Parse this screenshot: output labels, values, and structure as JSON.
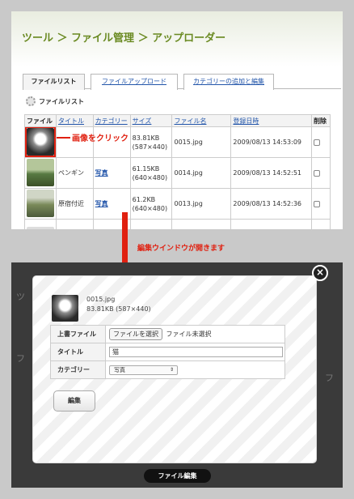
{
  "breadcrumb": "ツール ＞ ファイル管理 ＞ アップローダー",
  "tabs": [
    {
      "label": "ファイルリスト",
      "active": true
    },
    {
      "label": "ファイルアップロード",
      "active": false
    },
    {
      "label": "カテゴリーの追加と編集",
      "active": false
    }
  ],
  "section_title": "ファイルリスト",
  "table": {
    "headers": [
      "ファイル",
      "タイトル",
      "カテゴリー",
      "サイズ",
      "ファイル名",
      "登録日時",
      "削除"
    ],
    "rows": [
      {
        "title": "",
        "category": "",
        "size": "83.81KB",
        "dims": "(587×440)",
        "filename": "0015.jpg",
        "date": "2009/08/13 14:53:09"
      },
      {
        "title": "ペンギン",
        "category": "写真",
        "size": "61.15KB",
        "dims": "(640×480)",
        "filename": "0014.jpg",
        "date": "2009/08/13 14:52:51"
      },
      {
        "title": "原宿付近",
        "category": "写真",
        "size": "61.2KB",
        "dims": "(640×480)",
        "filename": "0013.jpg",
        "date": "2009/08/13 14:52:36"
      }
    ]
  },
  "callout": {
    "click_text": "画像をクリック"
  },
  "caption": "編集ウインドウが開きます",
  "modal": {
    "filename": "0015.jpg",
    "filesize": "83.81KB (587×440)",
    "form": {
      "overwrite_label": "上書ファイル",
      "choose_file_button": "ファイルを選択",
      "no_file_text": "ファイル未選択",
      "title_label": "タイトル",
      "title_value": "猫",
      "category_label": "カテゴリー",
      "category_value": "写真"
    },
    "edit_button": "編集",
    "footer_label": "ファイル編集",
    "close_glyph": "×"
  },
  "colors": {
    "accent_green": "#6a8a22",
    "callout_red": "#e02010",
    "link_blue": "#2255aa"
  }
}
